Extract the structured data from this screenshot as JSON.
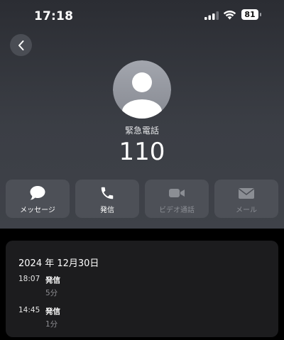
{
  "status_bar": {
    "time": "17:18",
    "battery": "81"
  },
  "contact": {
    "label": "緊急電話",
    "number": "110"
  },
  "actions": [
    {
      "label": "メッセージ",
      "icon": "message-icon",
      "enabled": true
    },
    {
      "label": "発信",
      "icon": "phone-icon",
      "enabled": true
    },
    {
      "label": "ビデオ通話",
      "icon": "video-icon",
      "enabled": false
    },
    {
      "label": "メール",
      "icon": "mail-icon",
      "enabled": false
    }
  ],
  "history": {
    "date": "2024 年 12月30日",
    "entries": [
      {
        "time": "18:07",
        "kind": "発信",
        "duration": "5分"
      },
      {
        "time": "14:45",
        "kind": "発信",
        "duration": "1分"
      }
    ]
  },
  "colors": {
    "background_top": "#2b2d33",
    "button_bg": "#4d5057",
    "card_bg": "#1c1c1e",
    "secondary_text": "#8e8e93"
  }
}
